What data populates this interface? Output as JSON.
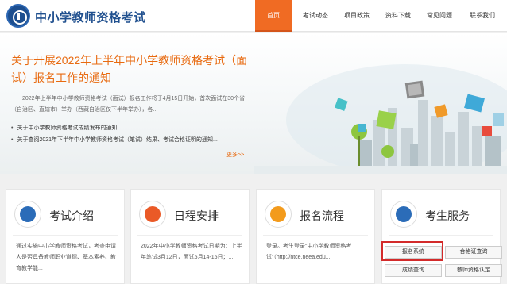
{
  "header": {
    "site_title": "中小学教师资格考试",
    "nav": [
      {
        "label": "首页",
        "active": true
      },
      {
        "label": "考试动态",
        "active": false
      },
      {
        "label": "项目政策",
        "active": false
      },
      {
        "label": "资料下载",
        "active": false
      },
      {
        "label": "常见问题",
        "active": false
      },
      {
        "label": "联系我们",
        "active": false
      }
    ]
  },
  "banner": {
    "title_line1": "关于开展2022年上半年中小学教师资格考试（面",
    "title_line2": "试）报名工作的通知",
    "body": "2022年上半年中小学教师资格考试（面试）报名工作将于4月15日开始，首次面试在30个省（自治区、直辖市）举办（西藏自治区仅下半年举办），各...",
    "bullets": [
      "关于中小学教师资格考试成绩发布的通知",
      "关于查阅2021年下半年中小学教师资格考试（笔试）结果、考试合格证明的通知..."
    ],
    "more": "更多>>"
  },
  "cards": [
    {
      "title": "考试介绍",
      "text": "通过实施中小学教师资格考试，考查申请人是否具备教师职业道德、基本素养、教育教学能..."
    },
    {
      "title": "日程安排",
      "text": "2022年中小学教师资格考试日期为：上半年笔试3月12日，面试5月14-15日；..."
    },
    {
      "title": "报名流程",
      "text": "登录。考生登录“中小学教师资格考试”（http://ntce.neea.edu...."
    },
    {
      "title": "考生服务",
      "text": ""
    }
  ],
  "services": {
    "signup": "报名系统",
    "certificate": "合格证查询",
    "score": "成绩查询",
    "qualification": "教师资格认定"
  },
  "colors": {
    "brand_blue": "#1f4f8e",
    "accent_orange": "#f06b23",
    "highlight_red": "#d32a2a"
  }
}
